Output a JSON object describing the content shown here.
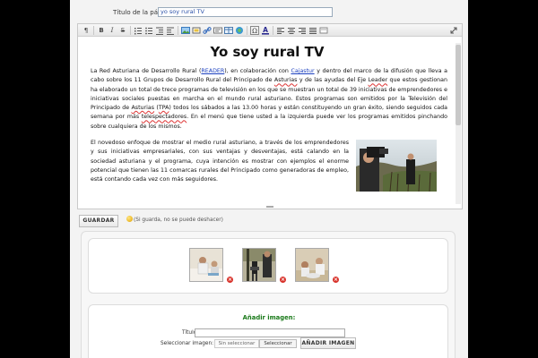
{
  "form": {
    "title_label": "Título de la página:",
    "title_value": "yo soy rural TV"
  },
  "toolbar": {
    "buttons": [
      "source-icon",
      "bold-icon",
      "italic-icon",
      "strike-icon",
      "list-ol-icon",
      "list-ul-icon",
      "outdent-icon",
      "indent-icon",
      "image-icon",
      "template-icon",
      "link-icon",
      "unlink-icon",
      "table-icon",
      "media-icon",
      "special-char-icon",
      "text-color-icon",
      "align-left-icon",
      "align-center-icon",
      "align-right-icon",
      "align-justify-icon",
      "clear-format-icon",
      "maximize-icon"
    ]
  },
  "document": {
    "title": "Yo soy rural TV",
    "p1": [
      {
        "t": "La Red Asturiana de Desarrollo Rural ("
      },
      {
        "t": "READER",
        "link": true
      },
      {
        "t": "), en colaboración con "
      },
      {
        "t": "Cajastur",
        "link": true
      },
      {
        "t": " y dentro del marco de la difusión que lleva a cabo sobre los 11 Grupos de Desarrollo Rural del Principado de "
      },
      {
        "t": "Asturias",
        "sp": true
      },
      {
        "t": " y de las ayudas del Eje "
      },
      {
        "t": "Leader",
        "sp": true
      },
      {
        "t": " que estos gestionan ha elaborado un total de trece programas de televisión en los que se muestran un total de 39 iniciativas de emprendedores e iniciativas sociales puestas en marcha en el mundo rural asturiano. Estos programas son emitidos por la Televisión del Principado de "
      },
      {
        "t": "Asturias",
        "sp": true
      },
      {
        "t": " ("
      },
      {
        "t": "TPA",
        "sp": true
      },
      {
        "t": ") todos los sábados a las 13.00 horas y están constituyendo un gran éxito, siendo seguidos cada semana por más "
      },
      {
        "t": "telespectadores",
        "sp": true
      },
      {
        "t": ". En el menú que tiene usted a la izquierda puede ver los programas emitidos pinchando sobre cualquiera de los mismos."
      }
    ],
    "p2": "El novedoso enfoque de mostrar el medio rural asturiano, a través de los emprendedores y sus iniciativas empresariales, con sus ventajas y desventajas, está calando en la sociedad asturiana y el programa, cuya intención es mostrar con ejemplos el enorme potencial que tienen las 11 comarcas rurales del Principado como generadoras de empleo, está contando cada vez con más seguidores."
  },
  "save": {
    "button_label": "GUARDAR",
    "hint": "(Si guarda, no se puede deshacer)"
  },
  "images": {
    "thumbnails": [
      "thumbnail-1",
      "thumbnail-2",
      "thumbnail-3"
    ],
    "add_title": "Añadir imagen:",
    "title_label": "Título",
    "title_value": "",
    "select_label": "Seleccionar imagen:",
    "file_none": "Sin seleccionar",
    "file_button": "Seleccionar",
    "add_button": "AÑADIR IMAGEN"
  },
  "colors": {
    "link": "#1a3fbf",
    "add_title": "#1a7a1a",
    "delete": "#d8322a"
  }
}
